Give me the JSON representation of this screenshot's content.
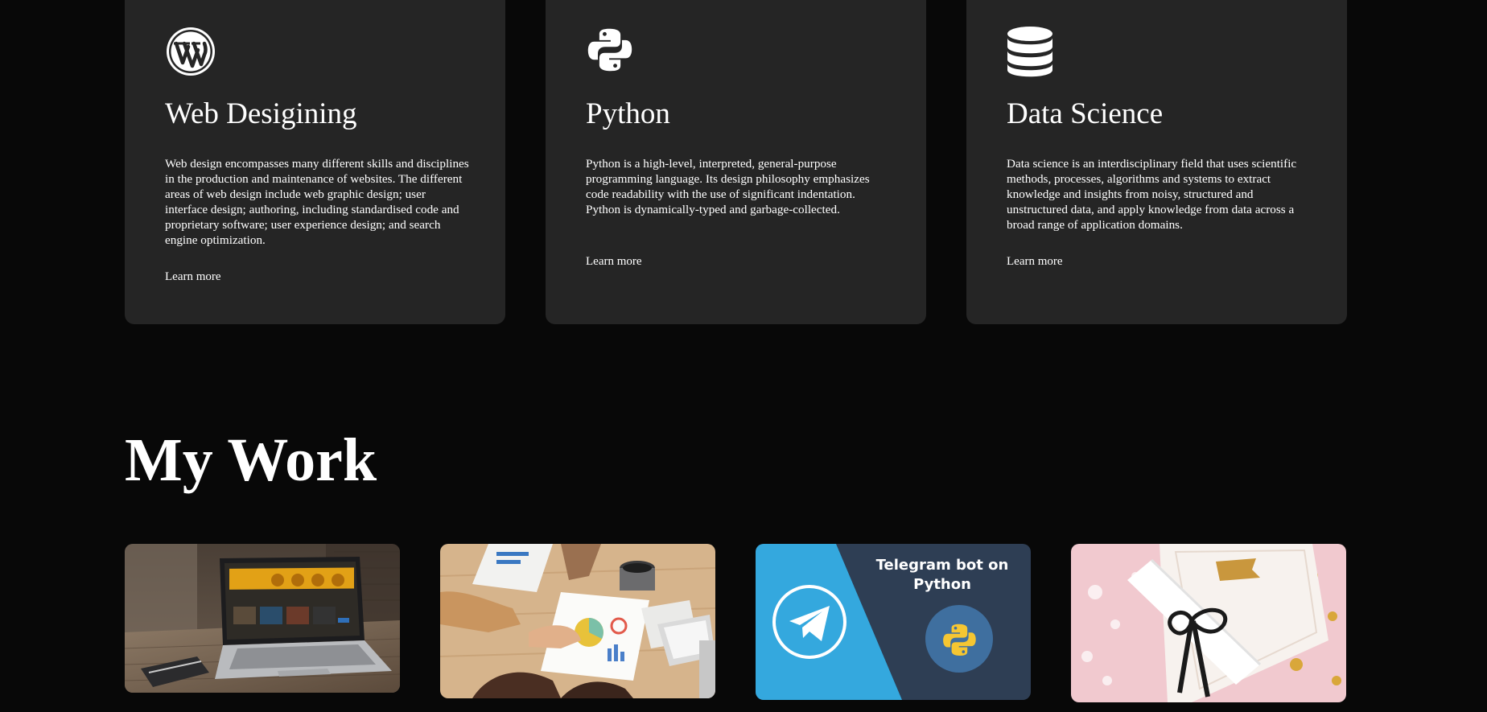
{
  "services": [
    {
      "title": "Web Desigining",
      "description": "Web design encompasses many different skills and disciplines in the production and maintenance of websites. The different areas of web design include web graphic design; user interface design; authoring, including standardised code and proprietary software; user experience design; and search engine optimization.",
      "link": "Learn more",
      "icon": "wordpress-icon"
    },
    {
      "title": "Python",
      "description": "Python is a high-level, interpreted, general-purpose programming language. Its design philosophy emphasizes code readability with the use of significant indentation. Python is dynamically-typed and garbage-collected.",
      "link": "Learn more",
      "icon": "python-icon"
    },
    {
      "title": "Data Science",
      "description": "Data science is an interdisciplinary field that uses scientific methods, processes, algorithms and systems to extract knowledge and insights from noisy, structured and unstructured data, and apply knowledge from data across a broad range of application domains.",
      "link": "Learn more",
      "icon": "database-icon"
    }
  ],
  "work": {
    "title": "My Work",
    "projects": [
      {
        "image": "laptop-website-photo"
      },
      {
        "image": "team-meeting-charts-photo"
      },
      {
        "image": "telegram-bot-python-thumbnail",
        "caption": [
          "Telegram bot on",
          "Python"
        ]
      },
      {
        "image": "certificate-scroll-photo"
      }
    ]
  },
  "colors": {
    "page_background": "#080808",
    "card_background": "#252525",
    "text": "#ffffff",
    "telegram_blue": "#34a8de",
    "telegram_dark": "#2e3e54",
    "python_blue": "#3f6f9f",
    "python_yellow": "#f5c632"
  }
}
